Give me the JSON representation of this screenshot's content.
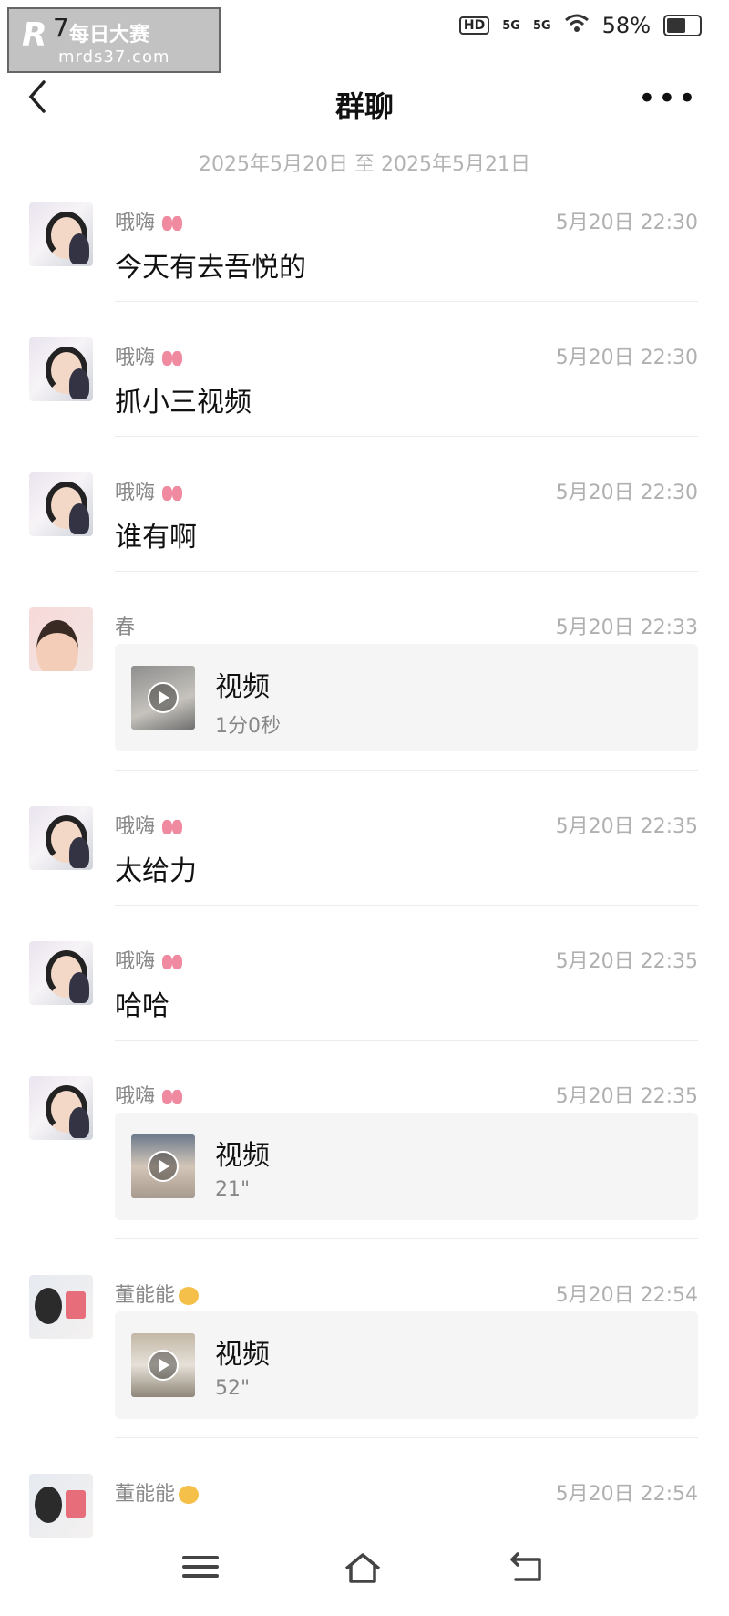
{
  "status_bar": {
    "time": "7",
    "battery_percent": "58%",
    "battery_level": 0.58,
    "watermark_title": "每日大赛",
    "watermark_url": "mrds37.com",
    "signal": [
      "HD",
      "5G",
      "5G"
    ]
  },
  "header": {
    "title": "群聊",
    "back_icon": "chevron-left-icon",
    "more_icon": "more-dots-icon",
    "more_label": "•••"
  },
  "date_range": "2025年5月20日 至 2025年5月21日",
  "messages": [
    {
      "sender": "哦嗨",
      "time": "5月20日 22:30",
      "type": "text",
      "text": "今天有去吾悦的"
    },
    {
      "sender": "哦嗨",
      "time": "5月20日 22:30",
      "type": "text",
      "text": "抓小三视频"
    },
    {
      "sender": "哦嗨",
      "time": "5月20日 22:30",
      "type": "text",
      "text": "谁有啊"
    },
    {
      "sender": "春",
      "time": "5月20日 22:33",
      "type": "video",
      "video_label": "视频",
      "duration": "1分0秒"
    },
    {
      "sender": "哦嗨",
      "time": "5月20日 22:35",
      "type": "text",
      "text": "太给力"
    },
    {
      "sender": "哦嗨",
      "time": "5月20日 22:35",
      "type": "text",
      "text": "哈哈"
    },
    {
      "sender": "哦嗨",
      "time": "5月20日 22:35",
      "type": "video",
      "video_label": "视频",
      "duration": "21\""
    },
    {
      "sender": "董能能",
      "time": "5月20日 22:54",
      "type": "video",
      "video_label": "视频",
      "duration": "52\""
    },
    {
      "sender": "董能能",
      "time": "5月20日 22:54",
      "type": "partial"
    }
  ],
  "nav_bar": {
    "icons": [
      "menu-icon",
      "home-icon",
      "back-icon"
    ]
  }
}
